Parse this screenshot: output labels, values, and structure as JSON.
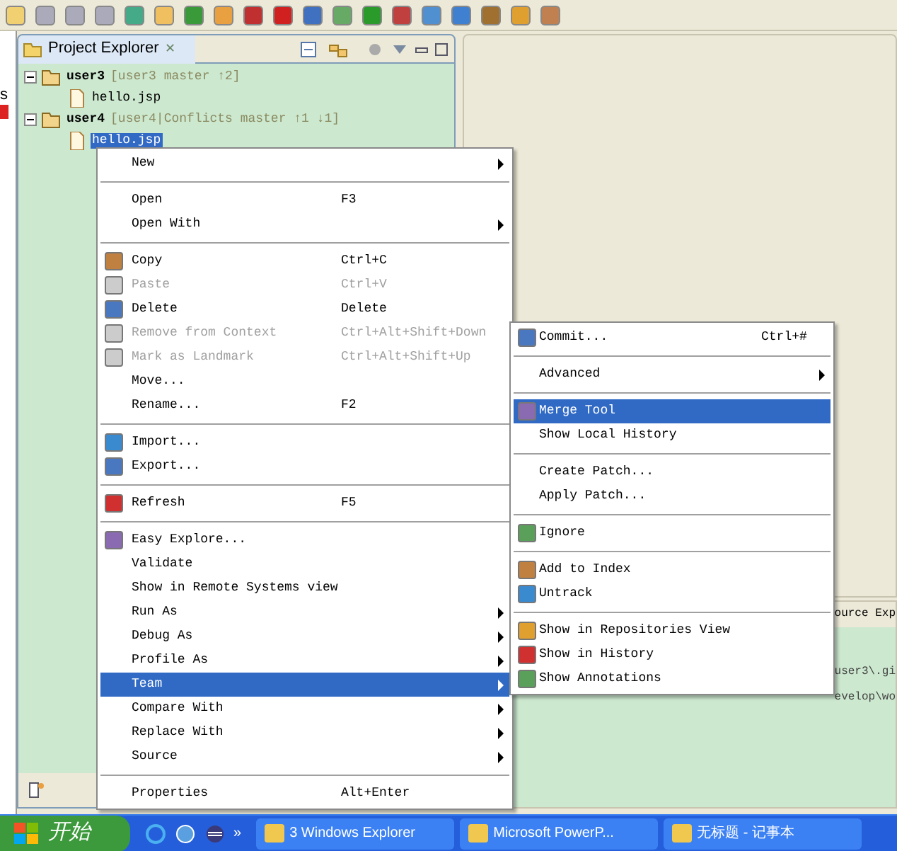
{
  "left_edge": {
    "text": "s"
  },
  "project_explorer": {
    "title": "Project Explorer",
    "close": "✕",
    "tree": [
      {
        "label": "user3",
        "decoration": "[user3 master ↑2]",
        "expanded": true,
        "selected": false,
        "children": [
          {
            "label": "hello.jsp",
            "selected": false
          }
        ]
      },
      {
        "label": "user4",
        "decoration": "[user4|Conflicts master ↑1 ↓1]",
        "expanded": true,
        "selected": false,
        "children": [
          {
            "label": "hello.jsp",
            "selected": true
          }
        ]
      }
    ]
  },
  "background_view": {
    "tab": "ource Exp",
    "lines": [
      "user3\\.gi",
      "evelop\\wo"
    ]
  },
  "context_menu": {
    "items": [
      {
        "kind": "item",
        "label": "New",
        "has_icon": false,
        "submenu": true,
        "disabled": false,
        "selected": false
      },
      {
        "kind": "separator"
      },
      {
        "kind": "item",
        "label": "Open",
        "shortcut": "F3",
        "has_icon": false,
        "submenu": false,
        "disabled": false,
        "selected": false
      },
      {
        "kind": "item",
        "label": "Open With",
        "has_icon": false,
        "submenu": true,
        "disabled": false,
        "selected": false
      },
      {
        "kind": "separator"
      },
      {
        "kind": "item",
        "label": "Copy",
        "shortcut": "Ctrl+C",
        "has_icon": true,
        "submenu": false,
        "disabled": false,
        "selected": false
      },
      {
        "kind": "item",
        "label": "Paste",
        "shortcut": "Ctrl+V",
        "has_icon": true,
        "submenu": false,
        "disabled": true,
        "selected": false
      },
      {
        "kind": "item",
        "label": "Delete",
        "shortcut": "Delete",
        "has_icon": true,
        "submenu": false,
        "disabled": false,
        "selected": false
      },
      {
        "kind": "item",
        "label": "Remove from Context",
        "shortcut": "Ctrl+Alt+Shift+Down",
        "has_icon": true,
        "submenu": false,
        "disabled": true,
        "selected": false
      },
      {
        "kind": "item",
        "label": "Mark as Landmark",
        "shortcut": "Ctrl+Alt+Shift+Up",
        "has_icon": true,
        "submenu": false,
        "disabled": true,
        "selected": false
      },
      {
        "kind": "item",
        "label": "Move...",
        "has_icon": false,
        "submenu": false,
        "disabled": false,
        "selected": false
      },
      {
        "kind": "item",
        "label": "Rename...",
        "shortcut": "F2",
        "has_icon": false,
        "submenu": false,
        "disabled": false,
        "selected": false
      },
      {
        "kind": "separator"
      },
      {
        "kind": "item",
        "label": "Import...",
        "has_icon": true,
        "submenu": false,
        "disabled": false,
        "selected": false
      },
      {
        "kind": "item",
        "label": "Export...",
        "has_icon": true,
        "submenu": false,
        "disabled": false,
        "selected": false
      },
      {
        "kind": "separator"
      },
      {
        "kind": "item",
        "label": "Refresh",
        "shortcut": "F5",
        "has_icon": true,
        "submenu": false,
        "disabled": false,
        "selected": false
      },
      {
        "kind": "separator"
      },
      {
        "kind": "item",
        "label": "Easy Explore...",
        "has_icon": true,
        "submenu": false,
        "disabled": false,
        "selected": false
      },
      {
        "kind": "item",
        "label": "Validate",
        "has_icon": false,
        "submenu": false,
        "disabled": false,
        "selected": false
      },
      {
        "kind": "item",
        "label": "Show in Remote Systems view",
        "has_icon": false,
        "submenu": false,
        "disabled": false,
        "selected": false
      },
      {
        "kind": "item",
        "label": "Run As",
        "has_icon": false,
        "submenu": true,
        "disabled": false,
        "selected": false
      },
      {
        "kind": "item",
        "label": "Debug As",
        "has_icon": false,
        "submenu": true,
        "disabled": false,
        "selected": false
      },
      {
        "kind": "item",
        "label": "Profile As",
        "has_icon": false,
        "submenu": true,
        "disabled": false,
        "selected": false
      },
      {
        "kind": "item",
        "label": "Team",
        "has_icon": false,
        "submenu": true,
        "disabled": false,
        "selected": true
      },
      {
        "kind": "item",
        "label": "Compare With",
        "has_icon": false,
        "submenu": true,
        "disabled": false,
        "selected": false
      },
      {
        "kind": "item",
        "label": "Replace With",
        "has_icon": false,
        "submenu": true,
        "disabled": false,
        "selected": false
      },
      {
        "kind": "item",
        "label": "Source",
        "has_icon": false,
        "submenu": true,
        "disabled": false,
        "selected": false
      },
      {
        "kind": "separator"
      },
      {
        "kind": "item",
        "label": "Properties",
        "shortcut": "Alt+Enter",
        "has_icon": false,
        "submenu": false,
        "disabled": false,
        "selected": false
      }
    ]
  },
  "team_submenu": {
    "items": [
      {
        "kind": "item",
        "label": "Commit...",
        "shortcut": "Ctrl+#",
        "has_icon": true,
        "submenu": false,
        "disabled": false,
        "selected": false
      },
      {
        "kind": "separator"
      },
      {
        "kind": "item",
        "label": "Advanced",
        "has_icon": false,
        "submenu": true,
        "disabled": false,
        "selected": false
      },
      {
        "kind": "separator"
      },
      {
        "kind": "item",
        "label": "Merge Tool",
        "has_icon": true,
        "submenu": false,
        "disabled": false,
        "selected": true
      },
      {
        "kind": "item",
        "label": "Show Local History",
        "has_icon": false,
        "submenu": false,
        "disabled": false,
        "selected": false
      },
      {
        "kind": "separator"
      },
      {
        "kind": "item",
        "label": "Create Patch...",
        "has_icon": false,
        "submenu": false,
        "disabled": false,
        "selected": false
      },
      {
        "kind": "item",
        "label": "Apply Patch...",
        "has_icon": false,
        "submenu": false,
        "disabled": false,
        "selected": false
      },
      {
        "kind": "separator"
      },
      {
        "kind": "item",
        "label": "Ignore",
        "has_icon": true,
        "submenu": false,
        "disabled": false,
        "selected": false
      },
      {
        "kind": "separator"
      },
      {
        "kind": "item",
        "label": "Add to Index",
        "has_icon": true,
        "submenu": false,
        "disabled": false,
        "selected": false
      },
      {
        "kind": "item",
        "label": "Untrack",
        "has_icon": true,
        "submenu": false,
        "disabled": false,
        "selected": false
      },
      {
        "kind": "separator"
      },
      {
        "kind": "item",
        "label": "Show in Repositories View",
        "has_icon": true,
        "submenu": false,
        "disabled": false,
        "selected": false
      },
      {
        "kind": "item",
        "label": "Show in History",
        "has_icon": true,
        "submenu": false,
        "disabled": false,
        "selected": false
      },
      {
        "kind": "item",
        "label": "Show Annotations",
        "has_icon": true,
        "submenu": false,
        "disabled": false,
        "selected": false
      }
    ]
  },
  "taskbar": {
    "start": "开始",
    "more": "»",
    "buttons": [
      {
        "label": "3 Windows Explorer",
        "selected": false
      },
      {
        "label": "Microsoft PowerP...",
        "selected": false
      },
      {
        "label": "无标题 - 记事本",
        "selected": false
      }
    ]
  }
}
